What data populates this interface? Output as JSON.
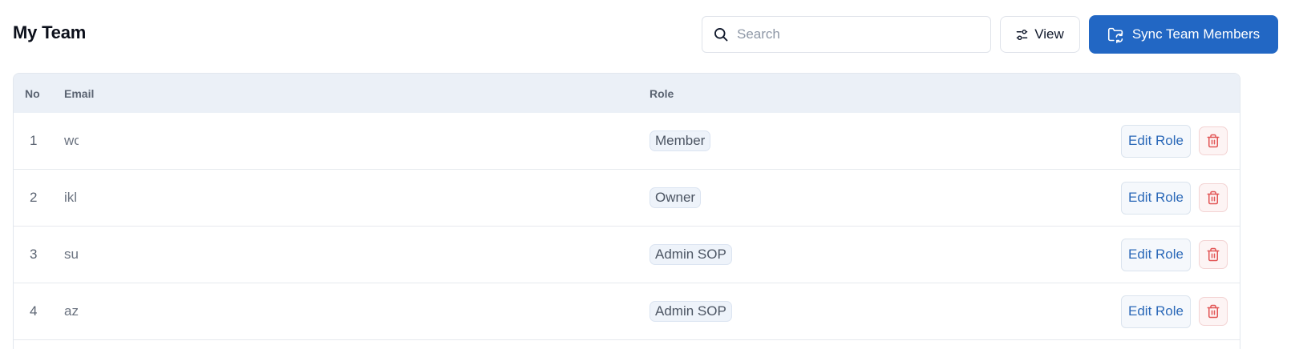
{
  "header": {
    "title": "My Team",
    "search_placeholder": "Search",
    "search_value": "",
    "view_label": "View",
    "sync_label": "Sync Team Members"
  },
  "table": {
    "columns": {
      "no": "No",
      "email": "Email",
      "role": "Role"
    },
    "edit_label": "Edit Role",
    "rows": [
      {
        "no": "1",
        "email": "wo",
        "role": "Member"
      },
      {
        "no": "2",
        "email": "ikl",
        "role": "Owner"
      },
      {
        "no": "3",
        "email": "su",
        "role": "Admin SOP"
      },
      {
        "no": "4",
        "email": "az",
        "role": "Admin SOP"
      }
    ]
  },
  "colors": {
    "accent": "#2267c4",
    "danger": "#e25555",
    "header_bg": "#ebf0f7"
  },
  "icons": {
    "search": "search-icon",
    "view": "sliders-icon",
    "sync": "folder-sync-icon",
    "delete": "trash-icon"
  }
}
